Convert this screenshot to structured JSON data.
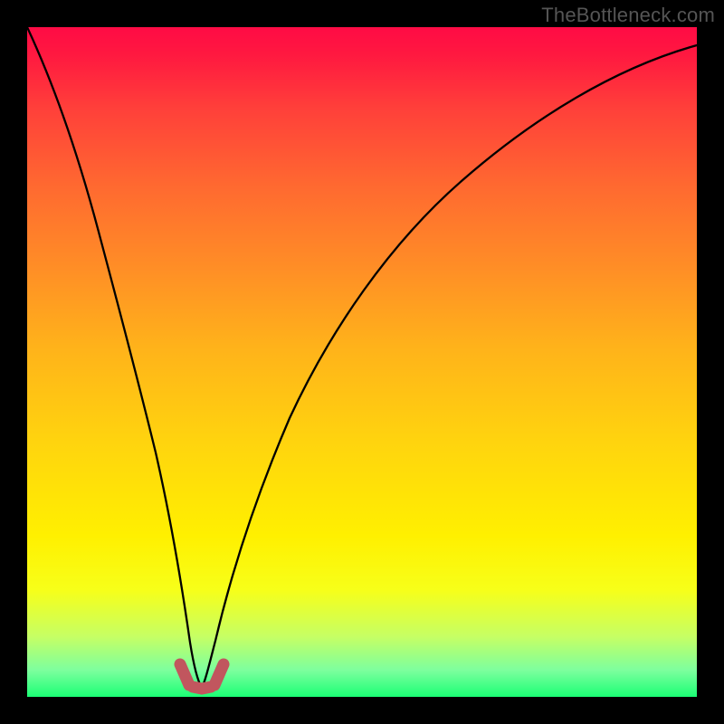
{
  "watermark": "TheBottleneck.com",
  "colors": {
    "frame_bg": "#000000",
    "curve_stroke": "#000000",
    "marker_stroke": "#c1565e",
    "gradient_stops": [
      "#ff0b45",
      "#ff1840",
      "#ff3f3a",
      "#ff6a30",
      "#ff8e26",
      "#ffb31a",
      "#ffd40e",
      "#fff000",
      "#f7ff19",
      "#c6ff64",
      "#7dff9e",
      "#1bff75"
    ]
  },
  "chart_data": {
    "type": "line",
    "title": "",
    "xlabel": "",
    "ylabel": "",
    "xlim": [
      0,
      100
    ],
    "ylim": [
      0,
      100
    ],
    "series": [
      {
        "name": "bottleneck-curve",
        "x": [
          0,
          3,
          6,
          9,
          12,
          15,
          18,
          20,
          22,
          24,
          26,
          28,
          30,
          34,
          38,
          44,
          50,
          58,
          66,
          76,
          86,
          100
        ],
        "y": [
          100,
          90,
          79,
          67,
          55,
          42,
          29,
          19,
          10,
          3,
          1,
          3,
          9,
          21,
          32,
          45,
          55,
          65,
          73,
          80,
          85,
          90
        ]
      }
    ],
    "markers": {
      "name": "trough-marker",
      "x": [
        22.7,
        23.7,
        24.5,
        25.3,
        26.2,
        27.5,
        28.6
      ],
      "y": [
        4.5,
        2.4,
        1.3,
        1.2,
        1.5,
        2.8,
        4.8
      ]
    }
  }
}
